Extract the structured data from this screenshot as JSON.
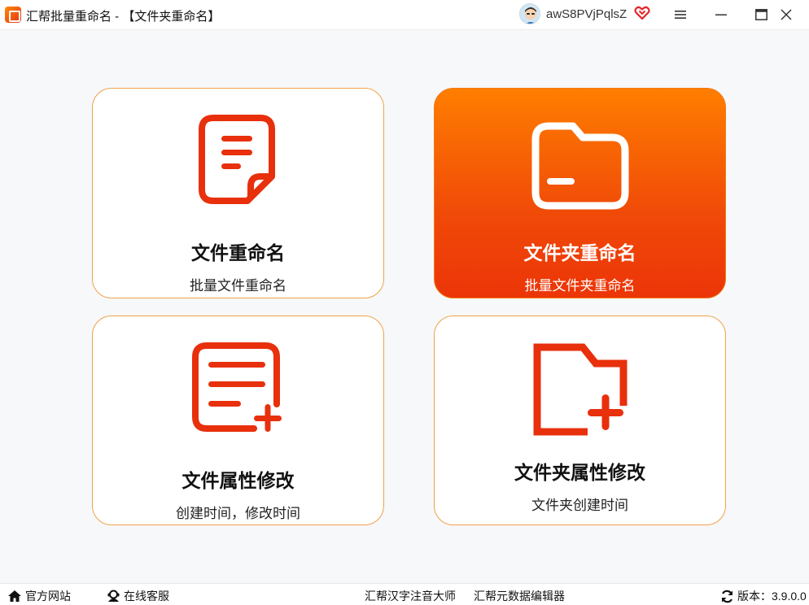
{
  "window": {
    "title": "汇帮批量重命名 - 【文件夹重命名】",
    "username": "awS8PVjPqlsZ"
  },
  "cards": [
    {
      "title": "文件重命名",
      "subtitle": "批量文件重命名",
      "icon": "file-document-icon",
      "active": false
    },
    {
      "title": "文件夹重命名",
      "subtitle": "批量文件夹重命名",
      "icon": "folder-icon",
      "active": true
    },
    {
      "title": "文件属性修改",
      "subtitle": "创建时间，修改时间",
      "icon": "file-add-icon",
      "active": false
    },
    {
      "title": "文件夹属性修改",
      "subtitle": "文件夹创建时间",
      "icon": "folder-add-icon",
      "active": false
    }
  ],
  "footer": {
    "website": "官方网站",
    "support": "在线客服",
    "link1": "汇帮汉字注音大师",
    "link2": "汇帮元数据编辑器",
    "version": "版本：3.9.0.0"
  },
  "colors": {
    "accent": "#f04a08",
    "accent_light": "#ff7e00",
    "icon_red": "#e8300c",
    "card_border": "#f0a24a"
  }
}
